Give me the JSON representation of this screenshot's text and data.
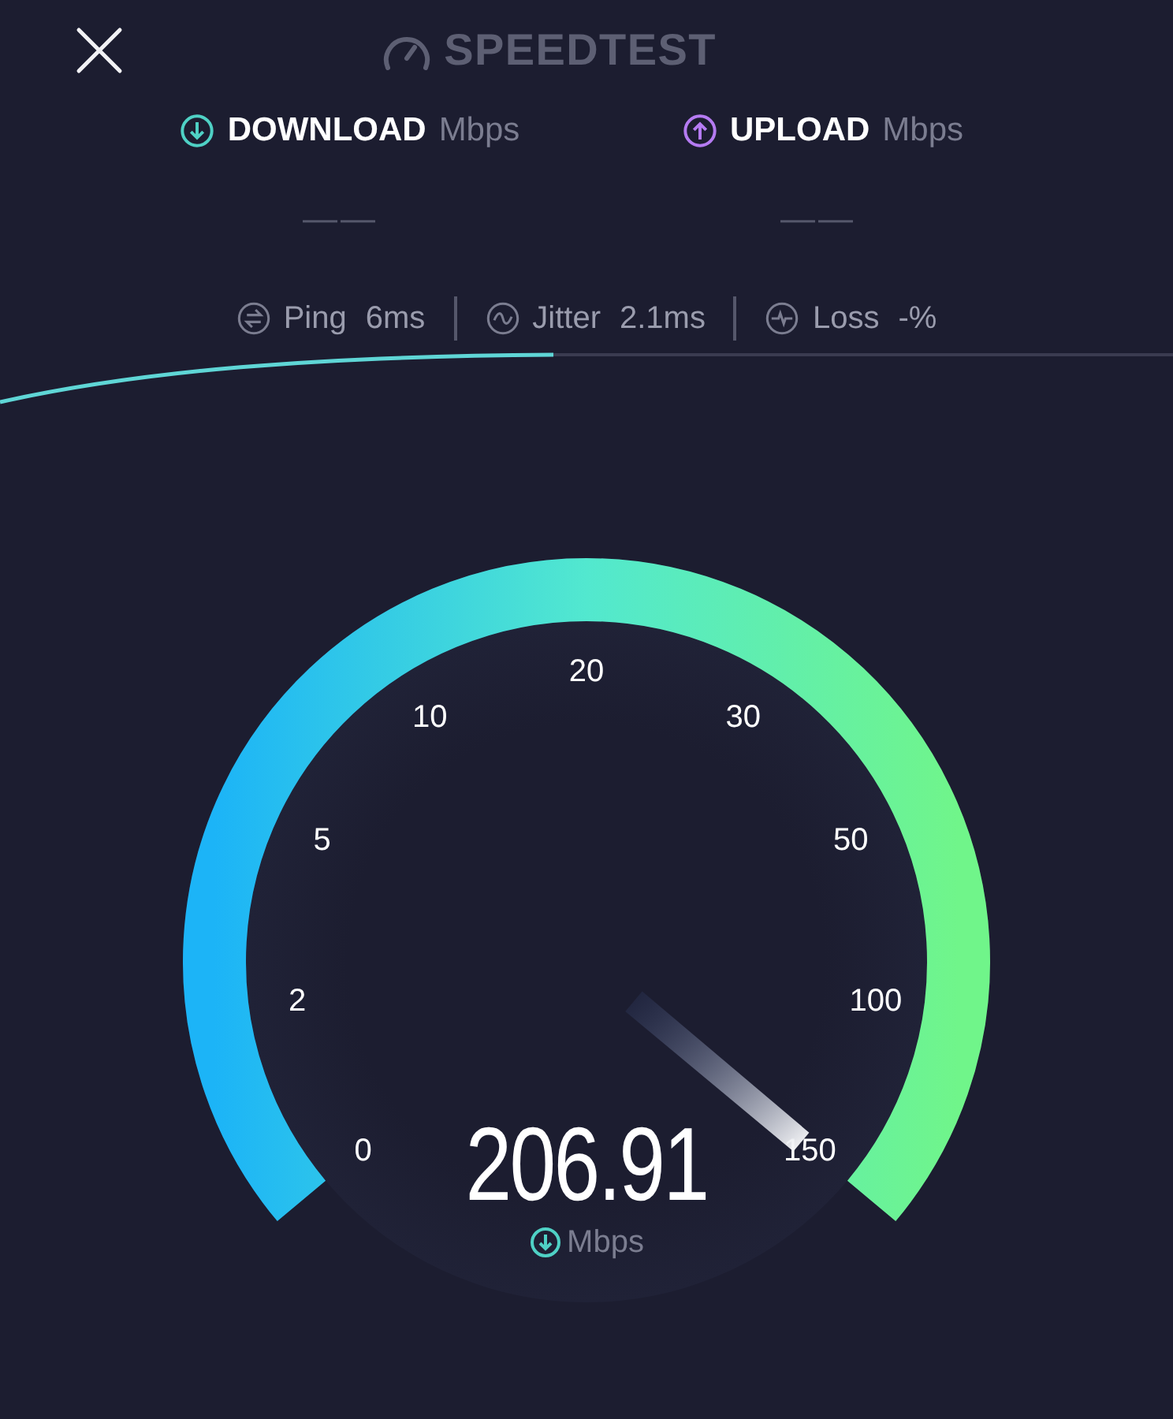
{
  "header": {
    "title": "SPEEDTEST"
  },
  "metrics": [
    {
      "kind": "download",
      "label": "DOWNLOAD",
      "unit": "Mbps",
      "value": "— —"
    },
    {
      "kind": "upload",
      "label": "UPLOAD",
      "unit": "Mbps",
      "value": "— —"
    }
  ],
  "stats": [
    {
      "kind": "ping",
      "label": "Ping",
      "value": "6ms"
    },
    {
      "kind": "jitter",
      "label": "Jitter",
      "value": "2.1ms"
    },
    {
      "kind": "loss",
      "label": "Loss",
      "value": "-%"
    }
  ],
  "gauge": {
    "scale": [
      "0",
      "2",
      "5",
      "10",
      "20",
      "30",
      "50",
      "100",
      "150"
    ],
    "reading": "206.91",
    "unit": "Mbps"
  }
}
